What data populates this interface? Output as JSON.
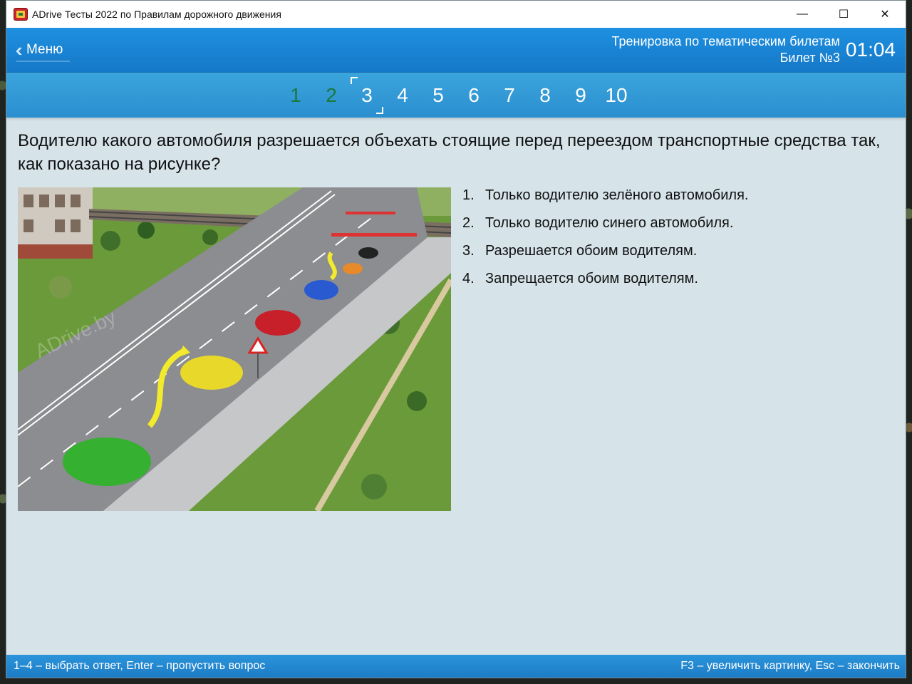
{
  "window": {
    "title": "ADrive Тесты 2022 по Правилам дорожного движения",
    "controls": {
      "minimize": "—",
      "maximize": "☐",
      "close": "✕"
    }
  },
  "header": {
    "menu_label": "Меню",
    "mode_title": "Тренировка по тематическим билетам",
    "ticket_label": "Билет №3",
    "timer": "01:04"
  },
  "tickets": {
    "items": [
      "1",
      "2",
      "3",
      "4",
      "5",
      "6",
      "7",
      "8",
      "9",
      "10"
    ],
    "done": [
      "1",
      "2"
    ],
    "current": "3"
  },
  "question": {
    "text": "Водителю какого автомобиля разрешается объехать стоящие перед переездом транспортные средства так, как показано на рисунке?",
    "watermark": "ADrive.by"
  },
  "answers": [
    {
      "num": "1.",
      "text": "Только водителю зелёного автомобиля."
    },
    {
      "num": "2.",
      "text": "Только водителю синего автомобиля."
    },
    {
      "num": "3.",
      "text": "Разрешается обоим водителям."
    },
    {
      "num": "4.",
      "text": "Запрещается обоим водителям."
    }
  ],
  "status": {
    "left": "1–4 – выбрать ответ, Enter – пропустить вопрос",
    "right": "F3 – увеличить картинку, Esc – закончить"
  },
  "colors": {
    "header_blue": "#1e90e0",
    "content_bg": "#d6e4ea",
    "done_green": "#1a7a3a"
  }
}
